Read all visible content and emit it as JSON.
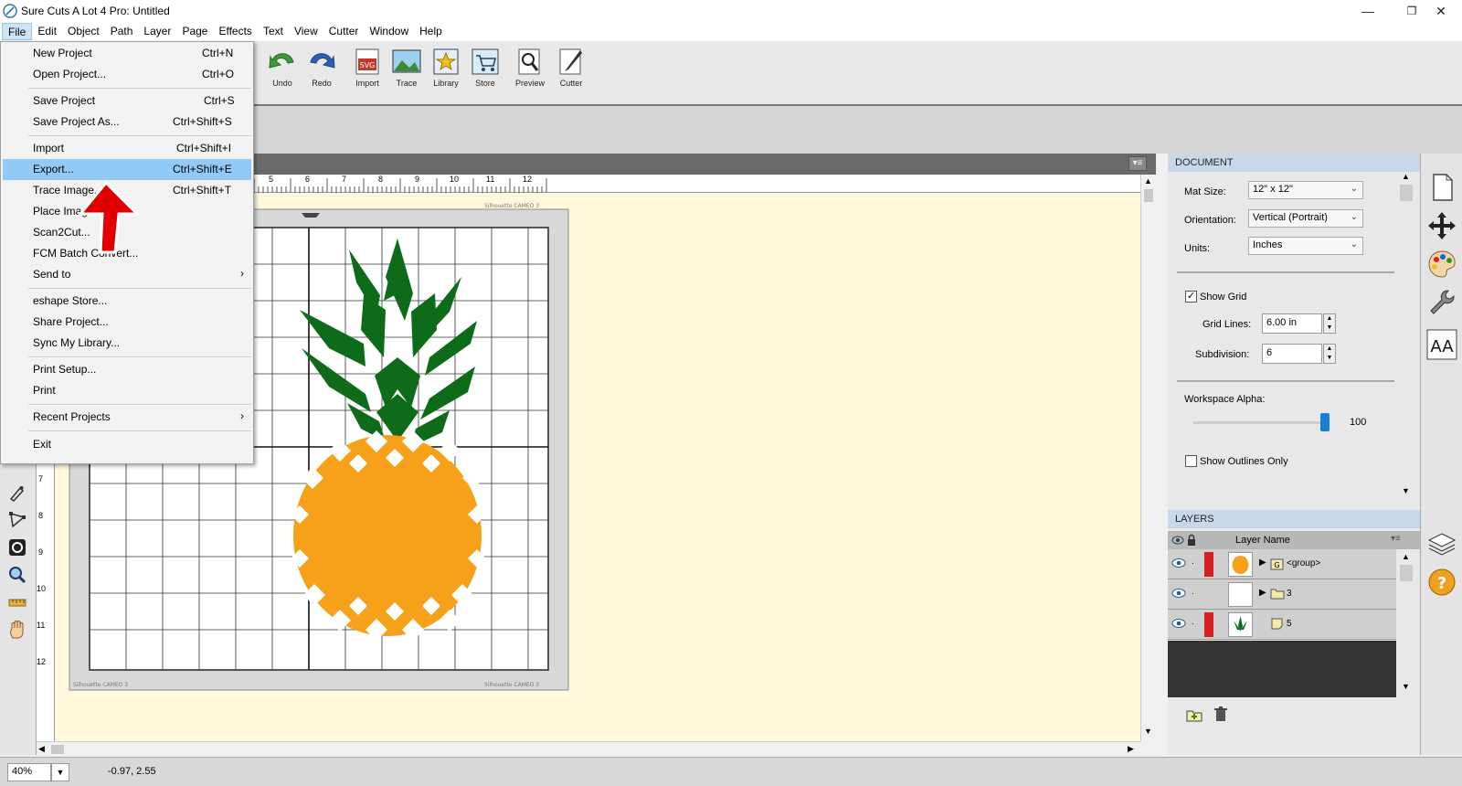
{
  "window": {
    "title": "Sure Cuts A Lot 4 Pro: Untitled",
    "minimize": "—",
    "maximize": "❐",
    "close": "✕"
  },
  "menubar": [
    "File",
    "Edit",
    "Object",
    "Path",
    "Layer",
    "Page",
    "Effects",
    "Text",
    "View",
    "Cutter",
    "Window",
    "Help"
  ],
  "toolbar": {
    "undo": "Undo",
    "redo": "Redo",
    "import": "Import",
    "trace": "Trace",
    "library": "Library",
    "store": "Store",
    "preview": "Preview",
    "cutter": "Cutter"
  },
  "file_menu": {
    "new_project": {
      "label": "New Project",
      "shortcut": "Ctrl+N"
    },
    "open_project": {
      "label": "Open Project...",
      "shortcut": "Ctrl+O"
    },
    "save_project": {
      "label": "Save Project",
      "shortcut": "Ctrl+S"
    },
    "save_project_as": {
      "label": "Save Project As...",
      "shortcut": "Ctrl+Shift+S"
    },
    "import": {
      "label": "Import",
      "shortcut": "Ctrl+Shift+I"
    },
    "export": {
      "label": "Export...",
      "shortcut": "Ctrl+Shift+E"
    },
    "trace_image": {
      "label": "Trace Image...",
      "shortcut": "Ctrl+Shift+T"
    },
    "place_image": {
      "label": "Place Image..."
    },
    "scan2cut": {
      "label": "Scan2Cut..."
    },
    "fcm_batch": {
      "label": "FCM Batch Convert..."
    },
    "send_to": {
      "label": "Send to"
    },
    "eshape_store": {
      "label": "eshape Store..."
    },
    "share_project": {
      "label": "Share Project..."
    },
    "sync_library": {
      "label": "Sync My Library..."
    },
    "print_setup": {
      "label": "Print Setup..."
    },
    "print": {
      "label": "Print"
    },
    "recent_projects": {
      "label": "Recent Projects"
    },
    "exit": {
      "label": "Exit"
    },
    "submenu_arrow": "›"
  },
  "rulers": {
    "horizontal": [
      "5",
      "6",
      "7",
      "8",
      "9",
      "10",
      "11",
      "12"
    ],
    "vertical": [
      "7",
      "8",
      "9",
      "10",
      "11",
      "12"
    ]
  },
  "mat": {
    "brand_top": "Silhouette CAMEO 3",
    "brand_bottom_left": "Silhouette CAMEO 3",
    "brand_bottom_right": "Silhouette CAMEO 3"
  },
  "document_panel": {
    "header": "DOCUMENT",
    "mat_size_label": "Mat Size:",
    "mat_size_value": "12\" x 12\"",
    "orientation_label": "Orientation:",
    "orientation_value": "Vertical (Portrait)",
    "units_label": "Units:",
    "units_value": "Inches",
    "show_grid_label": "Show Grid",
    "show_grid_checked": true,
    "grid_lines_label": "Grid Lines:",
    "grid_lines_value": "6.00 in",
    "subdivision_label": "Subdivision:",
    "subdivision_value": "6",
    "workspace_alpha_label": "Workspace Alpha:",
    "workspace_alpha_value": "100",
    "show_outlines_label": "Show Outlines Only",
    "show_outlines_checked": false
  },
  "layers_panel": {
    "header": "LAYERS",
    "column_name": "Layer Name",
    "rows": [
      {
        "name": "<group>",
        "color": "#d42020"
      },
      {
        "name": "3",
        "color": ""
      },
      {
        "name": "5",
        "color": "#d42020"
      }
    ]
  },
  "status": {
    "zoom": "40%",
    "coords": "-0.97, 2.55"
  },
  "colors": {
    "pineapple_leaves": "#0d6b1a",
    "pineapple_body": "#f7a11a",
    "workspace": "#fff8dc",
    "highlight": "#91c9f7",
    "arrow": "#e00000"
  }
}
